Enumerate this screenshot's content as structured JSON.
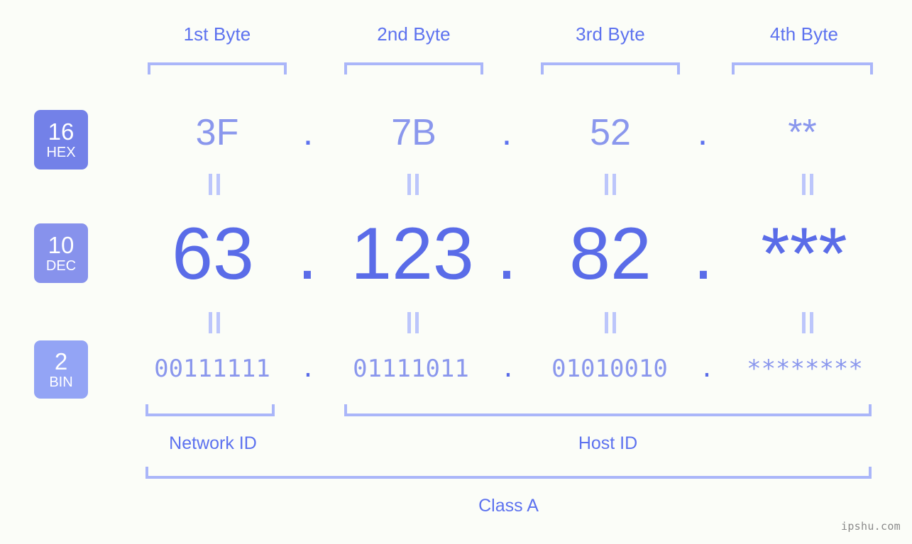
{
  "meta": {
    "background": "#fbfdf8",
    "accent_dark": "#5a6ce8",
    "accent_mid": "#8a97ed",
    "accent_light": "#aab6f9",
    "watermark": "ipshu.com"
  },
  "columns": [
    {
      "label": "1st Byte"
    },
    {
      "label": "2nd Byte"
    },
    {
      "label": "3rd Byte"
    },
    {
      "label": "4th Byte"
    }
  ],
  "bases": [
    {
      "number": "16",
      "name": "HEX",
      "color": "#7381e8"
    },
    {
      "number": "10",
      "name": "DEC",
      "color": "#8792ec"
    },
    {
      "number": "2",
      "name": "BIN",
      "color": "#93a4f5"
    }
  ],
  "rows": {
    "hex": {
      "base_number": "16",
      "base_name": "HEX",
      "values": [
        "3F",
        "7B",
        "52",
        "**"
      ],
      "separator": "."
    },
    "dec": {
      "base_number": "10",
      "base_name": "DEC",
      "values": [
        "63",
        "123",
        "82",
        "***"
      ],
      "separator": "."
    },
    "bin": {
      "base_number": "2",
      "base_name": "BIN",
      "values": [
        "00111111",
        "01111011",
        "01010010",
        "********"
      ],
      "separator": "."
    }
  },
  "equals_symbol": "||",
  "regions": [
    {
      "label": "Network ID"
    },
    {
      "label": "Host ID"
    }
  ],
  "class_label": "Class A",
  "ip_address": {
    "dec": "63.123.82.***",
    "hex": "3F.7B.52.**",
    "bin": "00111111.01111011.01010010.********"
  }
}
